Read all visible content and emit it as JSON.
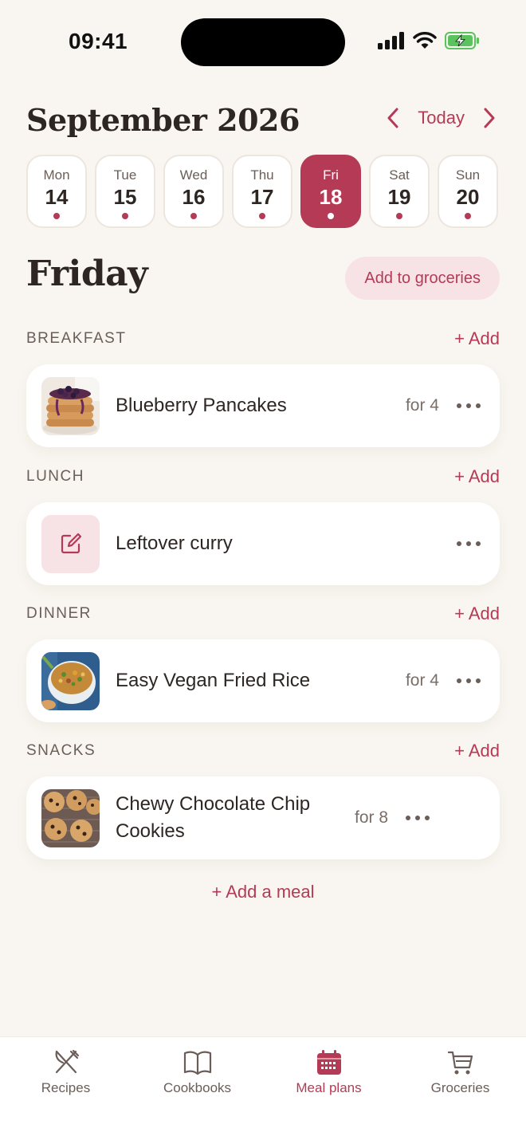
{
  "status_bar": {
    "time": "09:41"
  },
  "header": {
    "month_title": "September 2026",
    "today_label": "Today"
  },
  "week": [
    {
      "name": "Mon",
      "num": "14"
    },
    {
      "name": "Tue",
      "num": "15"
    },
    {
      "name": "Wed",
      "num": "16"
    },
    {
      "name": "Thu",
      "num": "17"
    },
    {
      "name": "Fri",
      "num": "18"
    },
    {
      "name": "Sat",
      "num": "19"
    },
    {
      "name": "Sun",
      "num": "20"
    }
  ],
  "selected_day": "Fri",
  "day_heading": "Friday",
  "groceries_button": "Add to groceries",
  "add_label": "+ Add",
  "sections": [
    {
      "label": "BREAKFAST",
      "meal": {
        "name": "Blueberry Pancakes",
        "servings": "for 4",
        "thumb": "pancakes-photo"
      }
    },
    {
      "label": "LUNCH",
      "meal": {
        "name": "Leftover curry",
        "servings": "",
        "thumb": "note-edit-icon"
      }
    },
    {
      "label": "DINNER",
      "meal": {
        "name": "Easy Vegan Fried Rice",
        "servings": "for 4",
        "thumb": "fried-rice-photo"
      }
    },
    {
      "label": "SNACKS",
      "meal": {
        "name": "Chewy Chocolate Chip Cookies",
        "servings": "for 8",
        "thumb": "cookies-photo"
      }
    }
  ],
  "add_meal_label": "+ Add a meal",
  "tabs": [
    {
      "label": "Recipes",
      "icon": "utensils-icon"
    },
    {
      "label": "Cookbooks",
      "icon": "book-icon"
    },
    {
      "label": "Meal plans",
      "icon": "calendar-icon"
    },
    {
      "label": "Groceries",
      "icon": "cart-icon"
    }
  ],
  "active_tab": "Meal plans",
  "colors": {
    "accent": "#B53A55",
    "background": "#F9F6F1",
    "accent_soft": "#F7E3E6",
    "text": "#2E2623"
  }
}
